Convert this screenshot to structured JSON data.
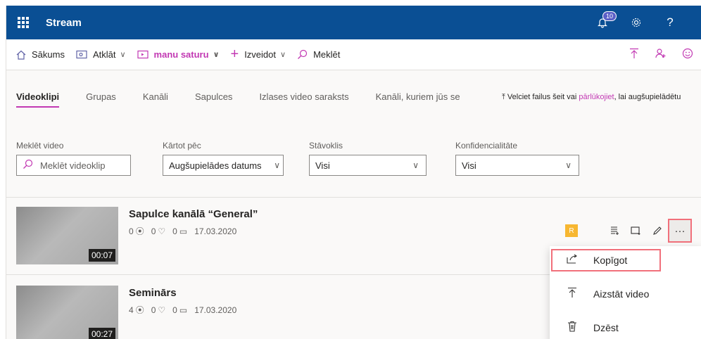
{
  "topbar": {
    "app_title": "Stream",
    "notification_count": "10",
    "help_label": "?"
  },
  "nav": {
    "home": "Sākums",
    "discover": "Atklāt",
    "my_content": "manu saturu",
    "create": "Izveidot",
    "search": "Meklēt"
  },
  "tabs": [
    {
      "label": "Videoklipi",
      "active": true
    },
    {
      "label": "Grupas"
    },
    {
      "label": "Kanāli"
    },
    {
      "label": "Sapulces"
    },
    {
      "label": "Izlases video saraksts"
    },
    {
      "label": "Kanāli, kuriem jūs se"
    }
  ],
  "upload_hint": {
    "prefix": "Velciet failus šeit vai ",
    "link": "pārlūkojiet",
    "suffix": ", lai augšupielādētu"
  },
  "filters": {
    "search": {
      "label": "Meklēt video",
      "placeholder": "Meklēt videoklip"
    },
    "sort": {
      "label": "Kārtot pēc",
      "value": "Augšupielādes datums"
    },
    "status": {
      "label": "Stāvoklis",
      "value": "Visi"
    },
    "privacy": {
      "label": "Konfidencialitāte",
      "value": "Visi"
    }
  },
  "videos": [
    {
      "title": "Sapulce kanālā “General”",
      "views": "0",
      "likes": "0",
      "comments": "0",
      "date": "17.03.2020",
      "duration": "00:07"
    },
    {
      "title": "Seminārs",
      "views": "4",
      "likes": "0",
      "comments": "0",
      "date": "17.03.2020",
      "duration": "00:27"
    }
  ],
  "actions": {
    "more_label": "···"
  },
  "menu": {
    "share": "Kopīgot",
    "replace": "Aizstāt video",
    "delete": "Dzēst"
  }
}
